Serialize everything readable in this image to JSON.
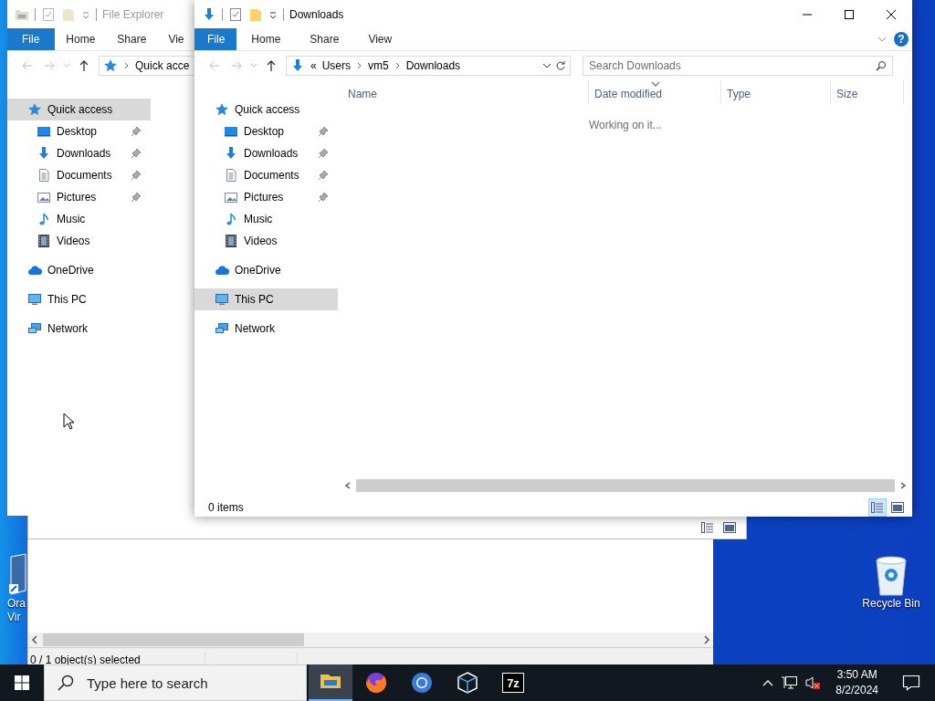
{
  "desktop_icons": [
    {
      "kind": "virtualbox",
      "lines": [
        "Ora",
        "Vir"
      ]
    },
    {
      "kind": "recycle-bin",
      "lines": [
        "Recycle Bin"
      ]
    }
  ],
  "list_window": {
    "view_buttons": [
      {
        "kind": "details",
        "selected": false
      },
      {
        "kind": "preview",
        "selected": false
      }
    ],
    "status": "0 / 1 object(s) selected"
  },
  "explorer_windows": [
    {
      "kind": "clipped",
      "active": false,
      "title": "File Explorer",
      "tabs": [
        {
          "kind": "file-menu",
          "label": "File"
        },
        {
          "kind": "tab",
          "label": "Home"
        },
        {
          "kind": "tab",
          "label": "Share"
        },
        {
          "kind": "tab",
          "label": "Vie"
        }
      ],
      "address": {
        "items": [
          {
            "label": "Quick acce",
            "separator_before": true
          }
        ]
      },
      "nav": [
        {
          "kind": "quick-access",
          "label": "Quick access",
          "selected": true,
          "children": [
            {
              "kind": "desktop",
              "label": "Desktop",
              "pinned": true,
              "selected": false
            },
            {
              "kind": "downloads",
              "label": "Downloads",
              "pinned": true,
              "selected": false
            },
            {
              "kind": "documents",
              "label": "Documents",
              "pinned": true,
              "selected": false
            },
            {
              "kind": "pictures",
              "label": "Pictures",
              "pinned": true,
              "selected": false
            },
            {
              "kind": "music",
              "label": "Music",
              "pinned": false,
              "selected": false
            },
            {
              "kind": "videos",
              "label": "Videos",
              "pinned": false,
              "selected": false
            }
          ]
        },
        {
          "kind": "onedrive",
          "label": "OneDrive",
          "selected": false
        },
        {
          "kind": "this-pc",
          "label": "This PC",
          "selected": false
        },
        {
          "kind": "network",
          "label": "Network",
          "selected": false
        }
      ]
    },
    {
      "kind": "full",
      "active": true,
      "title": "Downloads",
      "tabs": [
        {
          "kind": "file-menu",
          "label": "File"
        },
        {
          "kind": "tab",
          "label": "Home"
        },
        {
          "kind": "tab",
          "label": "Share"
        },
        {
          "kind": "tab",
          "label": "View"
        }
      ],
      "help": "?",
      "address": {
        "items": [
          {
            "label": "«",
            "separator_before": false
          },
          {
            "label": "Users",
            "separator_before": false
          },
          {
            "label": "vm5",
            "separator_before": true
          },
          {
            "label": "Downloads",
            "separator_before": true
          }
        ]
      },
      "search": {
        "placeholder": "Search Downloads"
      },
      "nav": [
        {
          "kind": "quick-access",
          "label": "Quick access",
          "selected": false,
          "children": [
            {
              "kind": "desktop",
              "label": "Desktop",
              "pinned": true,
              "selected": false
            },
            {
              "kind": "downloads",
              "label": "Downloads",
              "pinned": true,
              "selected": false
            },
            {
              "kind": "documents",
              "label": "Documents",
              "pinned": true,
              "selected": false
            },
            {
              "kind": "pictures",
              "label": "Pictures",
              "pinned": true,
              "selected": false
            },
            {
              "kind": "music",
              "label": "Music",
              "pinned": false,
              "selected": false
            },
            {
              "kind": "videos",
              "label": "Videos",
              "pinned": false,
              "selected": false
            }
          ]
        },
        {
          "kind": "onedrive",
          "label": "OneDrive",
          "selected": false
        },
        {
          "kind": "this-pc",
          "label": "This PC",
          "selected": true
        },
        {
          "kind": "network",
          "label": "Network",
          "selected": false
        }
      ],
      "columns": [
        {
          "label": "Name",
          "sorted": false
        },
        {
          "label": "Date modified",
          "sorted": true
        },
        {
          "label": "Type",
          "sorted": false
        },
        {
          "label": "Size",
          "sorted": false
        }
      ],
      "message": "Working on it...",
      "status": "0 items",
      "view_buttons": [
        {
          "kind": "details",
          "selected": true
        },
        {
          "kind": "preview",
          "selected": false
        }
      ]
    }
  ],
  "taskbar": {
    "search": {
      "placeholder": "Type here to search"
    },
    "apps": [
      {
        "kind": "file-explorer",
        "selected": true
      },
      {
        "kind": "firefox",
        "selected": false
      },
      {
        "kind": "chrome",
        "selected": false
      },
      {
        "kind": "virtualbox",
        "selected": false
      },
      {
        "kind": "sevenzip",
        "label": "7z",
        "selected": false
      }
    ],
    "clock": {
      "time": "3:50 AM",
      "date": "8/2/2024"
    }
  }
}
